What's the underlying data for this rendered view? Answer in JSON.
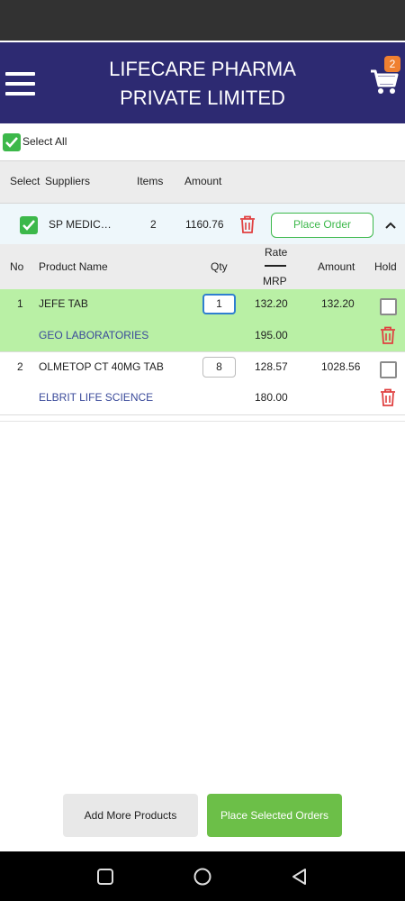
{
  "header": {
    "title_line1": "LIFECARE PHARMA",
    "title_line2": "PRIVATE LIMITED",
    "cart_count": "2"
  },
  "select_all": {
    "label": "Select All",
    "checked": true
  },
  "suppliers_table": {
    "columns": [
      "Select",
      "Suppliers",
      "Items",
      "Amount"
    ],
    "rows": [
      {
        "name": "SP MEDIC…",
        "items": "2",
        "amount": "1160.76",
        "button": "Place Order",
        "checked": true
      }
    ]
  },
  "products_table": {
    "columns": {
      "no": "No",
      "product": "Product Name",
      "qty": "Qty",
      "rate": "Rate",
      "mrp": "MRP",
      "amount": "Amount",
      "hold": "Hold"
    },
    "rows": [
      {
        "no": "1",
        "name": "JEFE TAB",
        "qty": "1",
        "rate": "132.20",
        "amount": "132.20",
        "manufacturer": "GEO LABORATORIES",
        "mrp": "195.00"
      },
      {
        "no": "2",
        "name": "OLMETOP CT 40MG TAB",
        "qty": "8",
        "rate": "128.57",
        "amount": "1028.56",
        "manufacturer": "ELBRIT LIFE SCIENCE",
        "mrp": "180.00"
      }
    ]
  },
  "buttons": {
    "add_more": "Add More Products",
    "place_selected": "Place Selected Orders"
  },
  "colors": {
    "header": "#2d2a72",
    "green": "#3cb84a",
    "selected_row": "#b9f0a5",
    "delete_red": "#e04040",
    "badge": "#f08030"
  }
}
